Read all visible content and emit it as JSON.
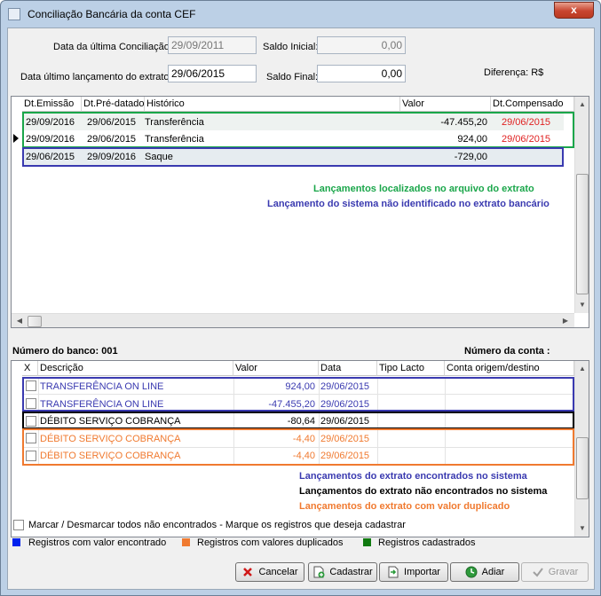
{
  "window": {
    "title": "Conciliação Bancária da conta CEF",
    "close_glyph": "x"
  },
  "header": {
    "ultima_conciliacao_label": "Data da última Conciliação:",
    "ultima_conciliacao_value": "29/09/2011",
    "saldo_inicial_label": "Saldo Inicial:",
    "saldo_inicial_value": "0,00",
    "ultimo_lancamento_label": "Data último lançamento do extrato:",
    "ultimo_lancamento_value": "29/06/2015",
    "saldo_final_label": "Saldo Final:",
    "saldo_final_value": "0,00",
    "diferenca_label": "Diferença: R$"
  },
  "top_grid": {
    "columns": [
      "Dt.Emissão",
      "Dt.Pré-datado",
      "Histórico",
      "Valor",
      "Dt.Compensado"
    ],
    "rows": [
      {
        "emissao": "29/09/2016",
        "predatado": "29/06/2015",
        "historico": "Transferência",
        "valor": "-47.455,20",
        "compensado": "29/06/2015"
      },
      {
        "emissao": "29/09/2016",
        "predatado": "29/06/2015",
        "historico": "Transferência",
        "valor": "924,00",
        "compensado": "29/06/2015"
      },
      {
        "emissao": "29/06/2015",
        "predatado": "29/09/2016",
        "historico": "Saque",
        "valor": "-729,00",
        "compensado": ""
      }
    ],
    "note_green": "Lançamentos localizados no arquivo do extrato",
    "note_blue": "Lançamento do sistema não identificado no extrato bancário"
  },
  "bank": {
    "numero_banco": "Número do banco: 001",
    "numero_conta": "Número da conta :"
  },
  "bottom_grid": {
    "columns": [
      "X",
      "Descrição",
      "Valor",
      "Data",
      "Tipo Lacto",
      "Conta origem/destino"
    ],
    "rows": [
      {
        "descricao": "TRANSFERÊNCIA ON LINE",
        "valor": "924,00",
        "data": "29/06/2015"
      },
      {
        "descricao": "TRANSFERÊNCIA ON LINE",
        "valor": "-47.455,20",
        "data": "29/06/2015"
      },
      {
        "descricao": "DÉBITO SERVIÇO COBRANÇA",
        "valor": "-80,64",
        "data": "29/06/2015"
      },
      {
        "descricao": "DÉBITO SERVIÇO COBRANÇA",
        "valor": "-4,40",
        "data": "29/06/2015"
      },
      {
        "descricao": "DÉBITO SERVIÇO COBRANÇA",
        "valor": "-4,40",
        "data": "29/06/2015"
      }
    ],
    "note_blue": "Lançamentos do extrato encontrados no sistema",
    "note_black": "Lançamentos do extrato não encontrados no sistema",
    "note_orange": "Lançamentos do extrato com valor duplicado"
  },
  "footer": {
    "marcar_label": "Marcar / Desmarcar todos não encontrados  - Marque os registros que deseja cadastrar",
    "legend": [
      {
        "label": "Registros com valor encontrado",
        "color": "#0022ee"
      },
      {
        "label": "Registros com valores duplicados",
        "color": "#f07a30"
      },
      {
        "label": "Registros cadastrados",
        "color": "#107a10"
      }
    ]
  },
  "buttons": {
    "cancelar": "Cancelar",
    "cadastrar": "Cadastrar",
    "importar": "Importar",
    "adiar": "Adiar",
    "gravar": "Gravar"
  },
  "colors": {
    "green": "#1aa64a",
    "blue": "#3a3ab0",
    "orange": "#f07a30",
    "red": "#e02020"
  }
}
